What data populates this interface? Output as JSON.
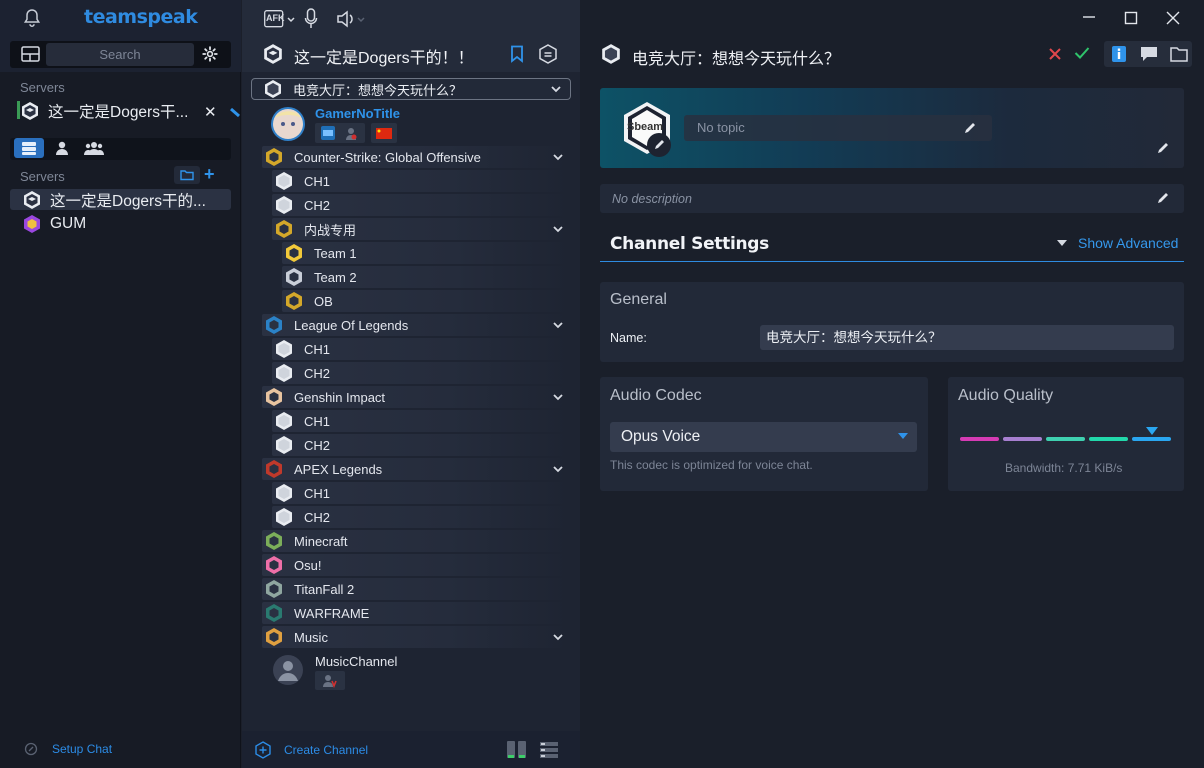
{
  "app": {
    "logo": "teamspeak"
  },
  "left": {
    "search_placeholder": "Search",
    "servers_label_top": "Servers",
    "bookmarked_server": "这一定是Dogers干...",
    "servers_label": "Servers",
    "servers": [
      {
        "name": "这一定是Dogers干的..."
      },
      {
        "name": "GUM"
      }
    ],
    "setup_chat": "Setup Chat"
  },
  "toolbar": {
    "afk_label": "AFK"
  },
  "channel_tree": {
    "server_title": "这一定是Dogers干的！！",
    "current_channel": "电竞大厅：想想今天玩什么？",
    "user": {
      "name": "GamerNoTitle"
    },
    "channels": [
      {
        "name": "Counter-Strike: Global Offensive",
        "level": 0,
        "expandable": true
      },
      {
        "name": "CH1",
        "level": 1
      },
      {
        "name": "CH2",
        "level": 1
      },
      {
        "name": "内战专用",
        "level": 1,
        "expandable": true
      },
      {
        "name": "Team 1",
        "level": 2
      },
      {
        "name": "Team 2",
        "level": 2
      },
      {
        "name": "OB",
        "level": 2
      },
      {
        "name": "League Of Legends",
        "level": 0,
        "expandable": true
      },
      {
        "name": "CH1",
        "level": 1
      },
      {
        "name": "CH2",
        "level": 1
      },
      {
        "name": "Genshin Impact",
        "level": 0,
        "expandable": true
      },
      {
        "name": "CH1",
        "level": 1
      },
      {
        "name": "CH2",
        "level": 1
      },
      {
        "name": "APEX Legends",
        "level": 0,
        "expandable": true
      },
      {
        "name": "CH1",
        "level": 1
      },
      {
        "name": "CH2",
        "level": 1
      },
      {
        "name": "Minecraft",
        "level": 0
      },
      {
        "name": "Osu!",
        "level": 0
      },
      {
        "name": "TitanFall 2",
        "level": 0
      },
      {
        "name": "WARFRAME",
        "level": 0
      },
      {
        "name": "Music",
        "level": 0,
        "expandable": true
      }
    ],
    "music_user": {
      "name": "MusicChannel"
    },
    "create_channel": "Create Channel"
  },
  "right": {
    "channel_title": "电竞大厅：想想今天玩什么？",
    "avatar_text": "Sbeam",
    "topic_placeholder": "No topic",
    "description_placeholder": "No description",
    "settings_title": "Channel Settings",
    "show_advanced": "Show Advanced",
    "general_title": "General",
    "name_label": "Name:",
    "name_value": "电竞大厅：想想今天玩什么？",
    "codec_title": "Audio Codec",
    "codec_value": "Opus Voice",
    "codec_hint": "This codec is optimized for voice chat.",
    "quality_title": "Audio Quality",
    "quality_level": 5,
    "quality_max": 5,
    "bandwidth": "Bandwidth: 7.71 KiB/s"
  },
  "colors": {
    "accent": "#2f8be0",
    "cancel": "#e0474c",
    "confirm": "#2fc36b",
    "quality_segments": [
      "#d63bb4",
      "#a77fd0",
      "#3fd0b0",
      "#22d8ab",
      "#2aa6f0"
    ]
  }
}
